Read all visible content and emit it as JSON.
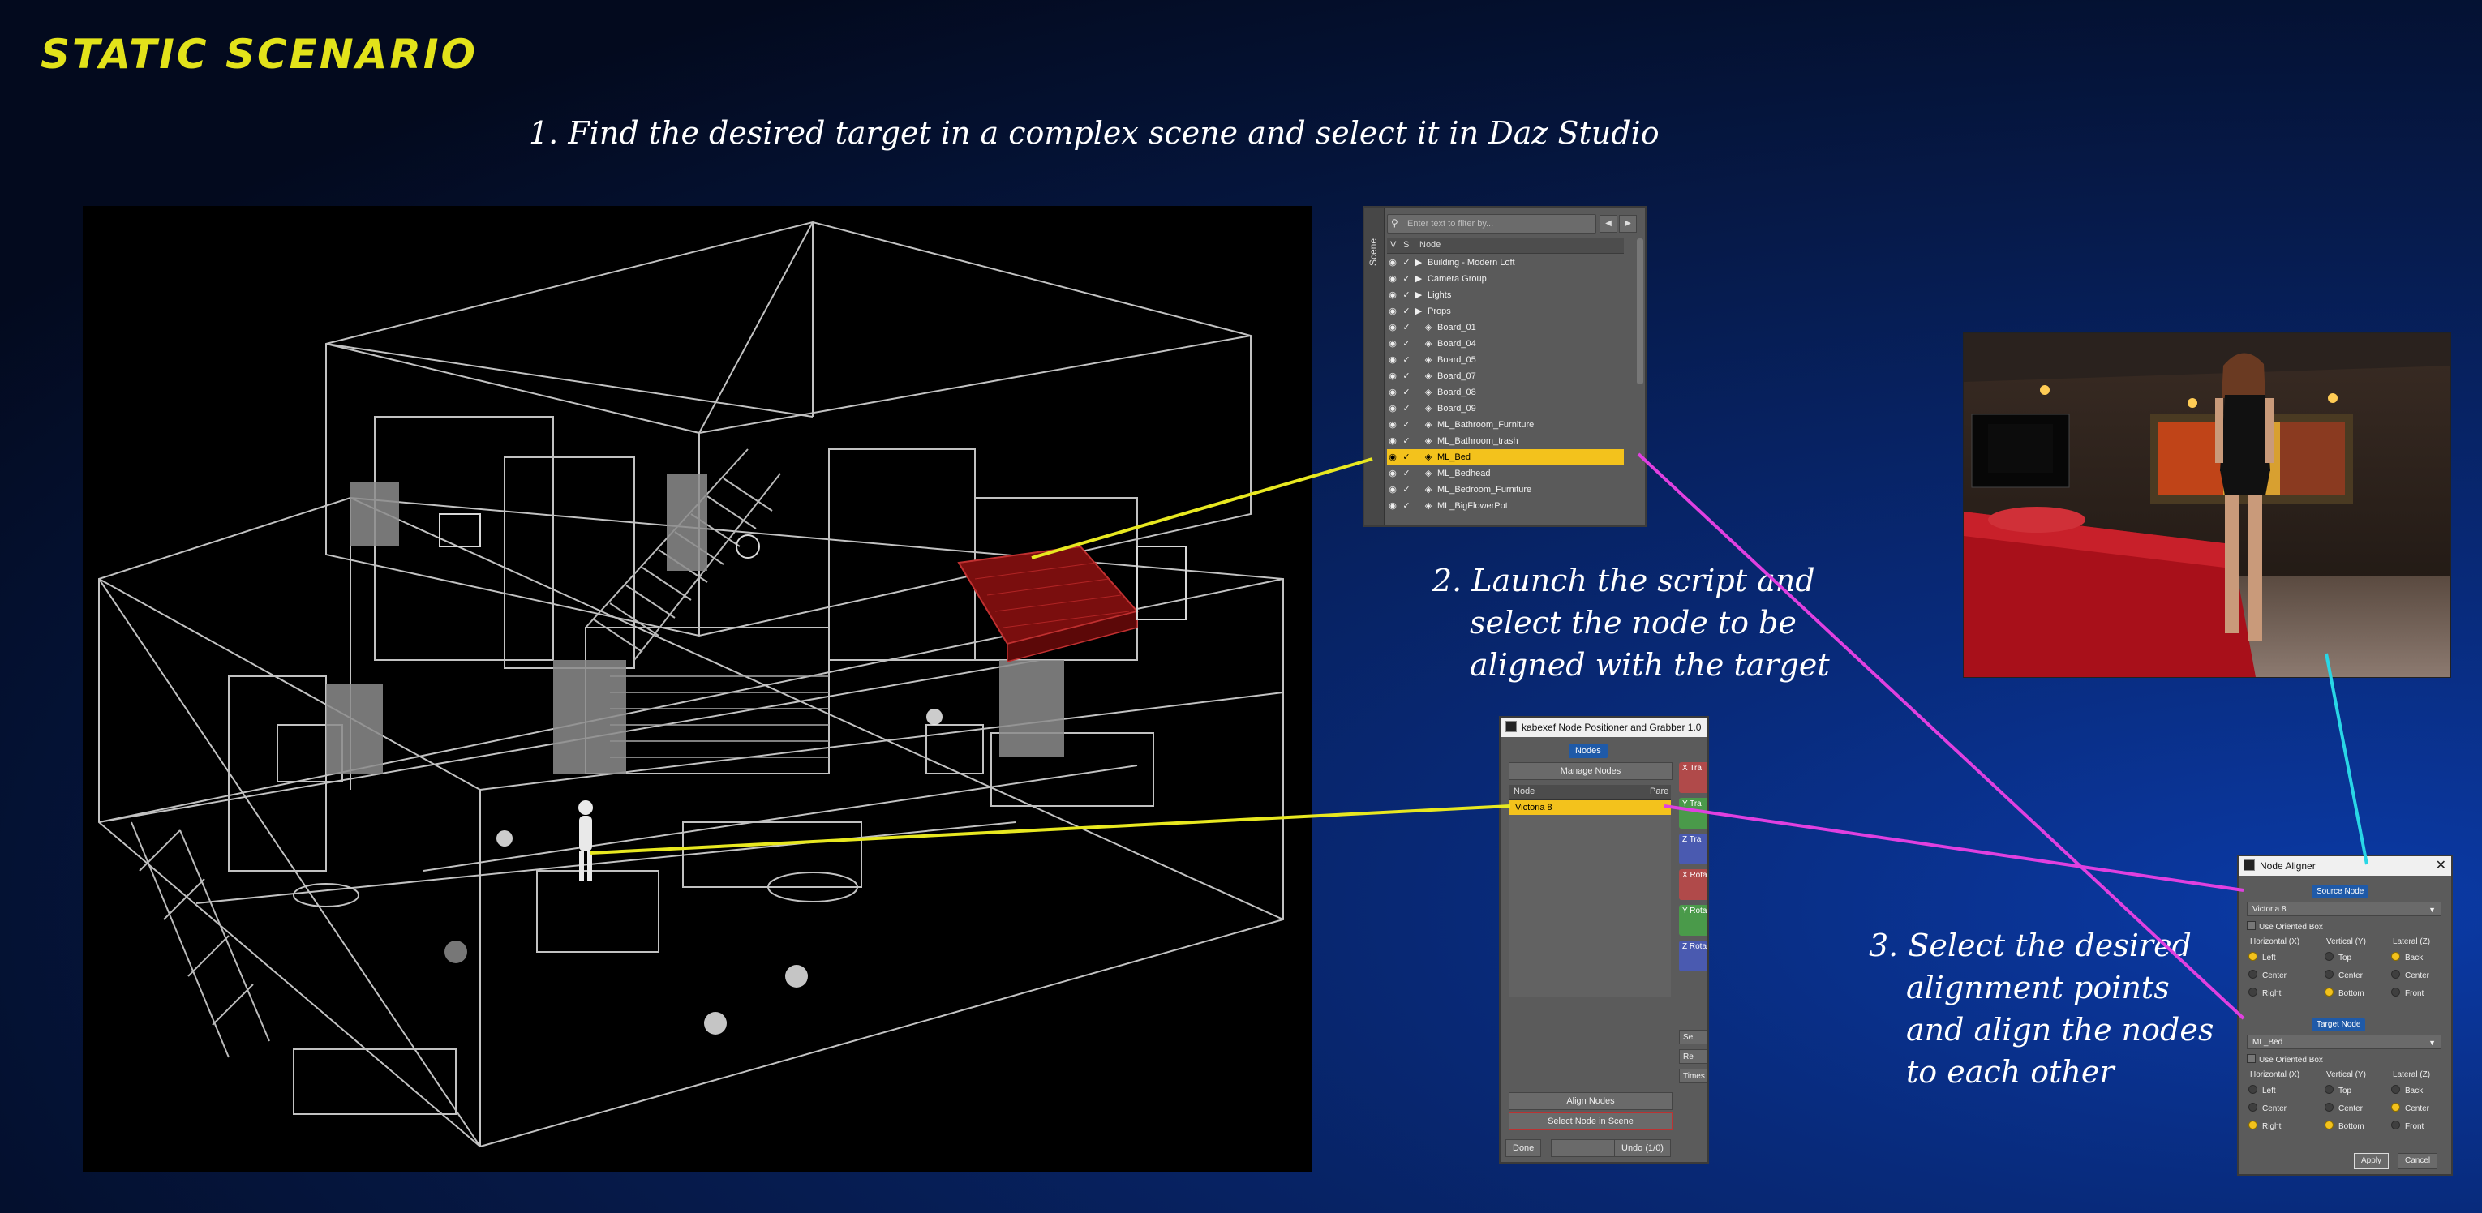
{
  "page": {
    "title": "STATIC SCENARIO",
    "step1": "1. Find the desired target in a complex scene and select it in Daz Studio",
    "step2": [
      "2. Launch the script and",
      "select the node to be",
      "aligned with the target"
    ],
    "step3": [
      "3. Select the desired",
      "alignment points",
      "and align the nodes",
      "to each other"
    ]
  },
  "colors": {
    "title": "#e2e21a",
    "selection": "#f3c21c",
    "connector_yellow": "#e8e820",
    "connector_magenta": "#e040e0",
    "connector_cyan": "#29d7e6",
    "bed": "#8a1010"
  },
  "scene_panel": {
    "tab_label": "Scene",
    "filter_placeholder": "Enter text to filter by...",
    "col_v": "V",
    "col_s": "S",
    "col_node": "Node",
    "items": [
      {
        "label": "Building - Modern Loft",
        "type": "group"
      },
      {
        "label": "Camera Group",
        "type": "group"
      },
      {
        "label": "Lights",
        "type": "group"
      },
      {
        "label": "Props",
        "type": "group"
      },
      {
        "label": "Board_01",
        "type": "prop"
      },
      {
        "label": "Board_04",
        "type": "prop"
      },
      {
        "label": "Board_05",
        "type": "prop"
      },
      {
        "label": "Board_07",
        "type": "prop"
      },
      {
        "label": "Board_08",
        "type": "prop"
      },
      {
        "label": "Board_09",
        "type": "prop"
      },
      {
        "label": "ML_Bathroom_Furniture",
        "type": "prop"
      },
      {
        "label": "ML_Bathroom_trash",
        "type": "prop"
      },
      {
        "label": "ML_Bed",
        "type": "prop",
        "selected": true
      },
      {
        "label": "ML_Bedhead",
        "type": "prop"
      },
      {
        "label": "ML_Bedroom_Furniture",
        "type": "prop"
      },
      {
        "label": "ML_BigFlowerPot",
        "type": "prop"
      }
    ]
  },
  "grabber": {
    "title": "kabexef Node Positioner and Grabber 1.0",
    "tab": "Nodes",
    "manage_nodes": "Manage Nodes",
    "col_node": "Node",
    "col_parent": "Pare",
    "nodes": [
      "Victoria 8"
    ],
    "side_panels": [
      "X Tra",
      "Y Tra",
      "Z Tra",
      "X Rota",
      "Y Rota",
      "Z Rota"
    ],
    "side_buttons": [
      "Se",
      "Re",
      "Times"
    ],
    "align_nodes": "Align Nodes",
    "select_node": "Select Node in Scene",
    "done": "Done",
    "undo": "Undo (1/0)"
  },
  "aligner": {
    "title": "Node Aligner",
    "source_label": "Source Node",
    "source_value": "Victoria 8",
    "target_label": "Target Node",
    "target_value": "ML_Bed",
    "use_oriented_box": "Use Oriented Box",
    "col_h": "Horizontal (X)",
    "col_v": "Vertical (Y)",
    "col_l": "Lateral (Z)",
    "source_options": {
      "h": [
        "Left",
        "Center",
        "Right"
      ],
      "h_sel": 0,
      "v": [
        "Top",
        "Center",
        "Bottom"
      ],
      "v_sel": 2,
      "l": [
        "Back",
        "Center",
        "Front"
      ],
      "l_sel": 0
    },
    "target_options": {
      "h": [
        "Left",
        "Center",
        "Right"
      ],
      "h_sel": 2,
      "v": [
        "Top",
        "Center",
        "Bottom"
      ],
      "v_sel": 2,
      "l": [
        "Back",
        "Center",
        "Front"
      ],
      "l_sel": 1
    },
    "apply": "Apply",
    "cancel": "Cancel"
  }
}
